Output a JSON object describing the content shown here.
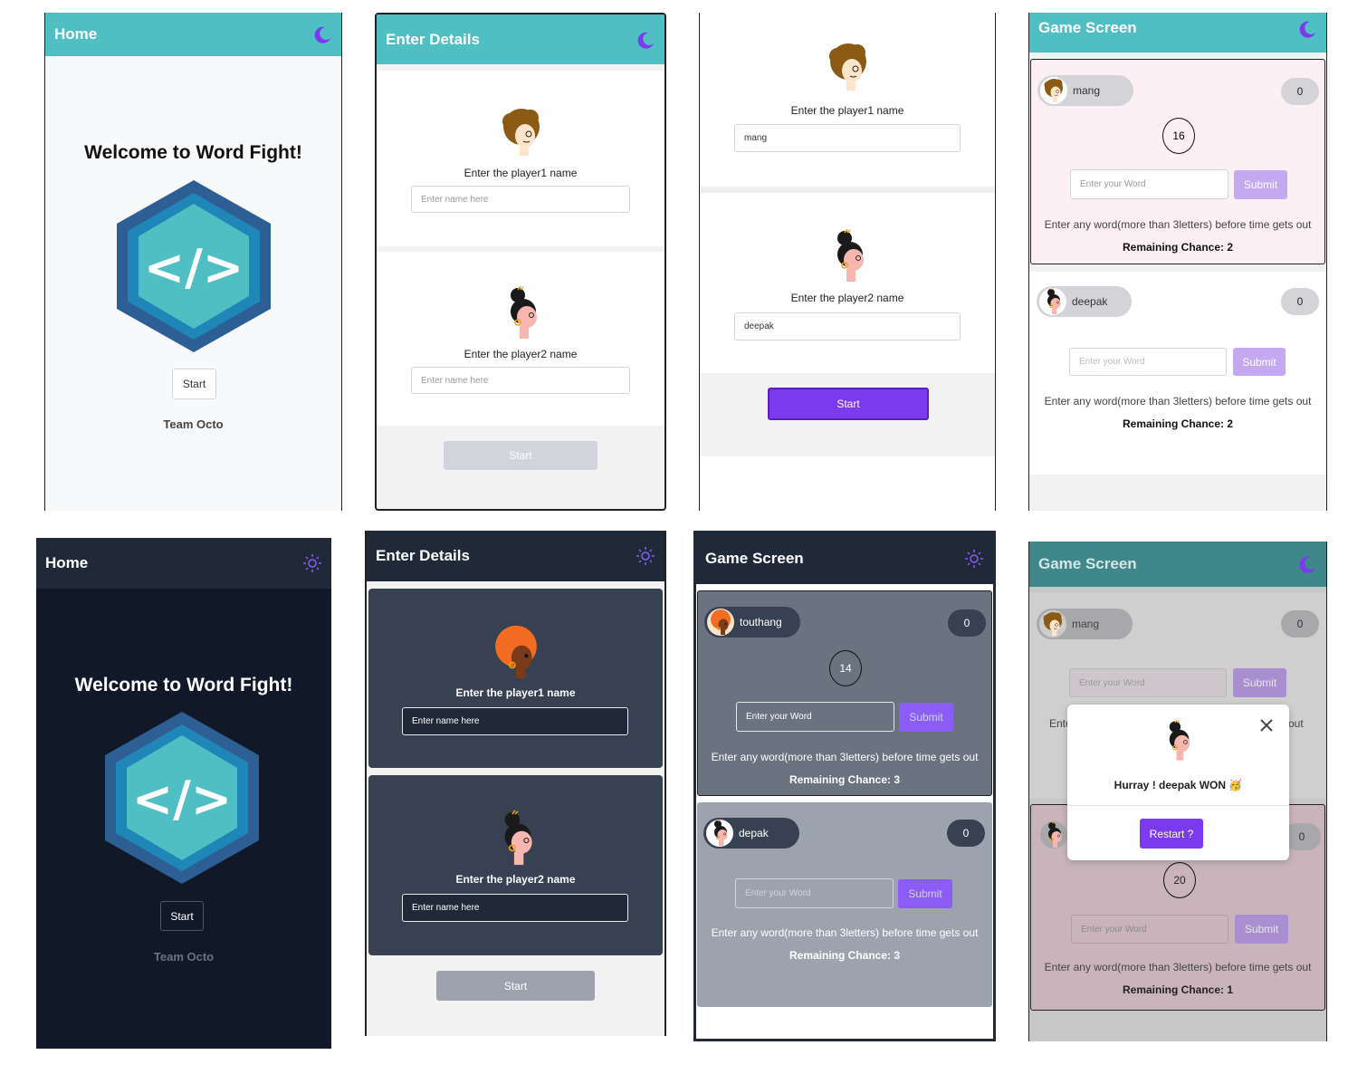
{
  "home": {
    "title": "Home",
    "welcome": "Welcome to Word Fight!",
    "logo_symbol": "</>",
    "start_label": "Start",
    "team": "Team Octo",
    "theme_icon": "moon-icon"
  },
  "details": {
    "title": "Enter Details",
    "player1_label": "Enter the player1 name",
    "player2_label": "Enter the player2 name",
    "name_placeholder": "Enter name here",
    "start_label": "Start",
    "theme_icon": "moon-icon"
  },
  "details_filled": {
    "player1_label": "Enter the player1 name",
    "player1_value": "mang",
    "player2_label": "Enter the player2 name",
    "player2_value": "deepak",
    "start_label": "Start"
  },
  "game": {
    "title": "Game Screen",
    "p1": {
      "name": "mang",
      "score": "0",
      "timer": "16",
      "word_placeholder": "Enter your Word",
      "submit": "Submit",
      "hint": "Enter any word(more than 3letters) before time gets out",
      "chance": "Remaining Chance: 2"
    },
    "p2": {
      "name": "deepak",
      "score": "0",
      "word_placeholder": "Enter your Word",
      "submit": "Submit",
      "hint": "Enter any word(more than 3letters) before time gets out",
      "chance": "Remaining Chance: 2"
    }
  },
  "home_dark": {
    "title": "Home",
    "welcome": "Welcome to Word Fight!",
    "logo_symbol": "</>",
    "start_label": "Start",
    "team": "Team Octo",
    "theme_icon": "sun-icon"
  },
  "details_dark": {
    "title": "Enter Details",
    "player1_label": "Enter the player1 name",
    "player2_label": "Enter the player2 name",
    "name_placeholder": "Enter name here",
    "start_label": "Start",
    "theme_icon": "sun-icon"
  },
  "game_dark": {
    "title": "Game Screen",
    "p1": {
      "name": "touthang",
      "score": "0",
      "timer": "14",
      "word_placeholder": "Enter your Word",
      "submit": "Submit",
      "hint": "Enter any word(more than 3letters) before time gets out",
      "chance": "Remaining Chance: 3"
    },
    "p2": {
      "name": "depak",
      "score": "0",
      "word_placeholder": "Enter your Word",
      "submit": "Submit",
      "hint": "Enter any word(more than 3letters) before time gets out",
      "chance": "Remaining Chance: 3"
    }
  },
  "game_modal": {
    "title": "Game Screen",
    "p1": {
      "name": "mang",
      "score": "0",
      "word_placeholder": "Enter your Word",
      "submit": "Submit",
      "hint_left": "Ente",
      "hint_right": "out"
    },
    "p2": {
      "score": "0",
      "timer": "20",
      "word_placeholder": "Enter your Word",
      "submit": "Submit",
      "hint": "Enter any word(more than 3letters) before time gets out",
      "chance": "Remaining Chance: 1"
    },
    "modal": {
      "message": "Hurray ! deepak WON 🥳",
      "restart": "Restart ?",
      "close_icon": "close-icon"
    }
  },
  "colors": {
    "teal": "#4fbfc4",
    "purple": "#7c3aed",
    "lavender": "#c4a8f0",
    "navy": "#111827",
    "dark_header": "#1f2937"
  }
}
